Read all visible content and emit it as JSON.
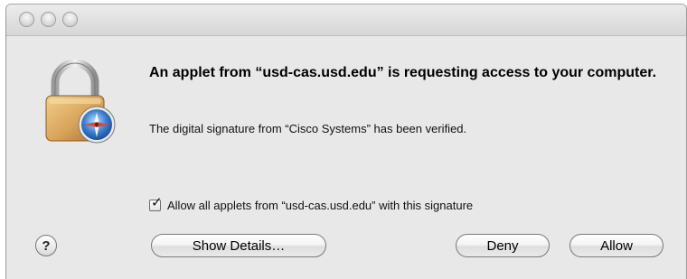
{
  "dialog": {
    "heading": "An applet from “usd-cas.usd.edu” is requesting access to your computer.",
    "message": "The digital signature from “Cisco Systems” has been verified.",
    "checkbox": {
      "label": "Allow all applets from “usd-cas.usd.edu” with this signature",
      "checked": true,
      "mark": "✓"
    },
    "help_label": "?",
    "buttons": {
      "show_details": "Show Details…",
      "deny": "Deny",
      "allow": "Allow"
    }
  },
  "icons": {
    "window_controls": [
      "close-icon",
      "minimize-icon",
      "zoom-icon"
    ],
    "app_icon": "padlock-compass-icon"
  },
  "colors": {
    "window_bg": "#e8e8e8",
    "lock_gold": "#d9a35a",
    "compass_blue": "#3b7fd1"
  }
}
